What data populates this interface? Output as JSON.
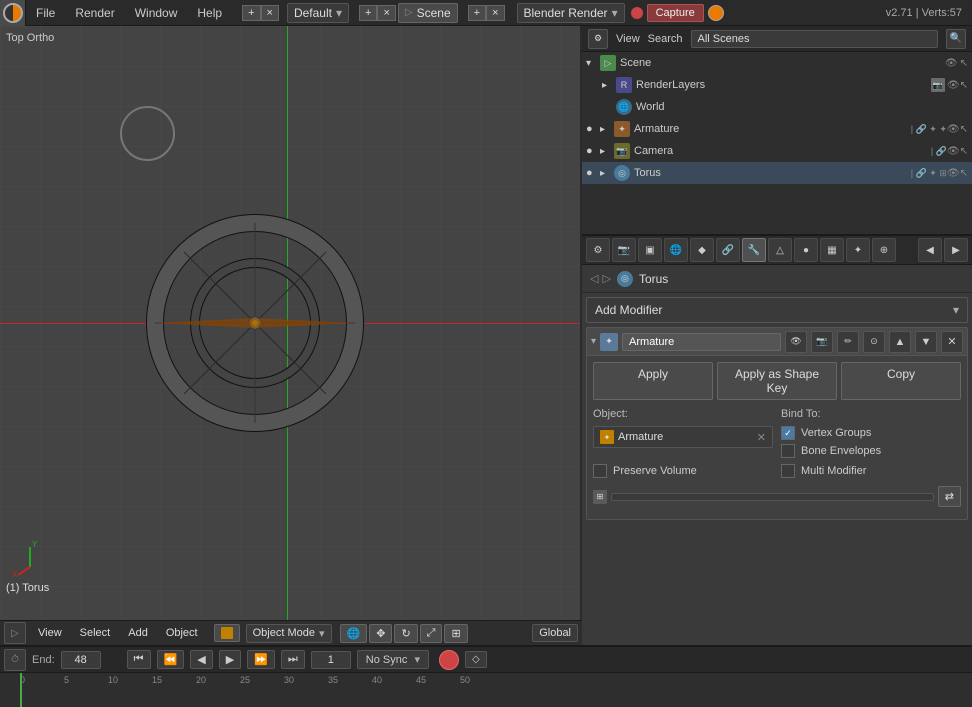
{
  "app": {
    "title": "Blender",
    "version": "v2.71 | Verts:57"
  },
  "menubar": {
    "items": [
      "File",
      "Render",
      "Window",
      "Help"
    ],
    "workspace": "Default",
    "scene": "Scene",
    "render_engine": "Blender Render",
    "capture_label": "Capture"
  },
  "viewport": {
    "label": "Top Ortho",
    "bottom_bar": {
      "view_label": "View",
      "select_label": "Select",
      "add_label": "Add",
      "object_label": "Object",
      "mode_label": "Object Mode",
      "global_label": "Global"
    },
    "selected_object": "(1) Torus"
  },
  "outliner": {
    "header": {
      "view_label": "View",
      "search_label": "Search",
      "all_scenes_label": "All Scenes"
    },
    "items": [
      {
        "name": "Scene",
        "type": "scene",
        "indent": 0,
        "expanded": true
      },
      {
        "name": "RenderLayers",
        "type": "renderlayers",
        "indent": 1,
        "expanded": false
      },
      {
        "name": "World",
        "type": "world",
        "indent": 1,
        "expanded": false
      },
      {
        "name": "Armature",
        "type": "armature",
        "indent": 1,
        "expanded": false
      },
      {
        "name": "Camera",
        "type": "camera",
        "indent": 1,
        "expanded": false
      },
      {
        "name": "Torus",
        "type": "torus",
        "indent": 1,
        "expanded": false
      }
    ]
  },
  "properties": {
    "tabs": [
      "scene",
      "render",
      "layers",
      "world",
      "object",
      "constraints",
      "modifier",
      "data",
      "material",
      "texture",
      "particles",
      "physics"
    ],
    "active_tab": "modifier",
    "breadcrumb": {
      "object_name": "Torus"
    },
    "add_modifier_label": "Add Modifier",
    "modifier": {
      "name": "Armature",
      "buttons": {
        "apply_label": "Apply",
        "apply_shape_label": "Apply as Shape Key",
        "copy_label": "Copy"
      },
      "object_label": "Object:",
      "object_value": "Armature",
      "bind_to_label": "Bind To:",
      "preserve_volume_label": "Preserve Volume",
      "vertex_groups_label": "Vertex Groups",
      "bone_envelopes_label": "Bone Envelopes",
      "multi_modifier_label": "Multi Modifier",
      "vertex_group_field": "",
      "vertex_groups_checked": true,
      "bone_envelopes_checked": false,
      "multi_modifier_checked": false,
      "preserve_volume_checked": false
    }
  },
  "timeline": {
    "end_label": "End:",
    "end_value": "48",
    "frame_value": "1",
    "sync_label": "No Sync",
    "ticks": [
      "0",
      "5",
      "10",
      "15",
      "20",
      "25",
      "30",
      "35",
      "40",
      "45",
      "50"
    ]
  }
}
